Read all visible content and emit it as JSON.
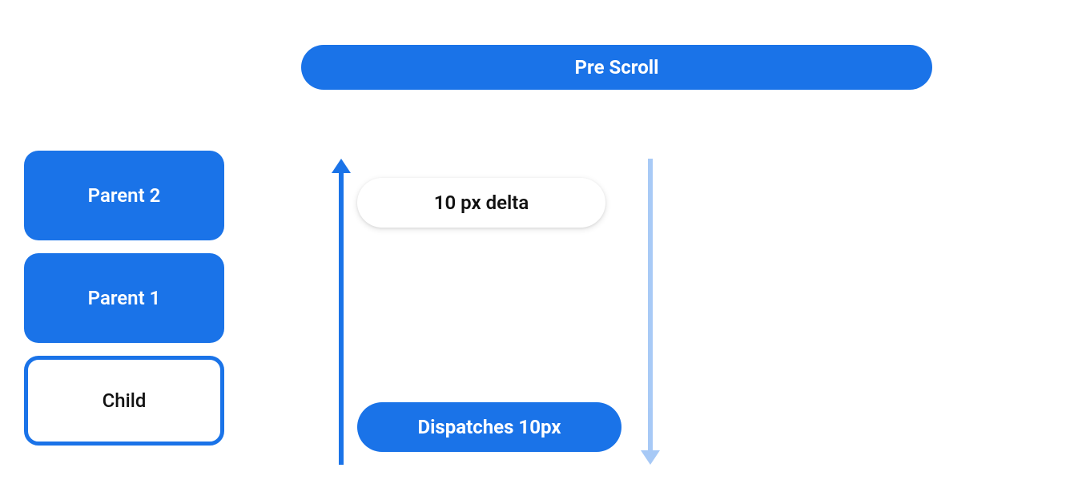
{
  "title": "Pre Scroll",
  "hierarchy": {
    "parent2": "Parent 2",
    "parent1": "Parent 1",
    "child": "Child"
  },
  "delta_label": "10 px delta",
  "dispatch_label": "Dispatches 10px",
  "colors": {
    "primary": "#1a73e8",
    "arrow_down_opacity": 0.38
  }
}
